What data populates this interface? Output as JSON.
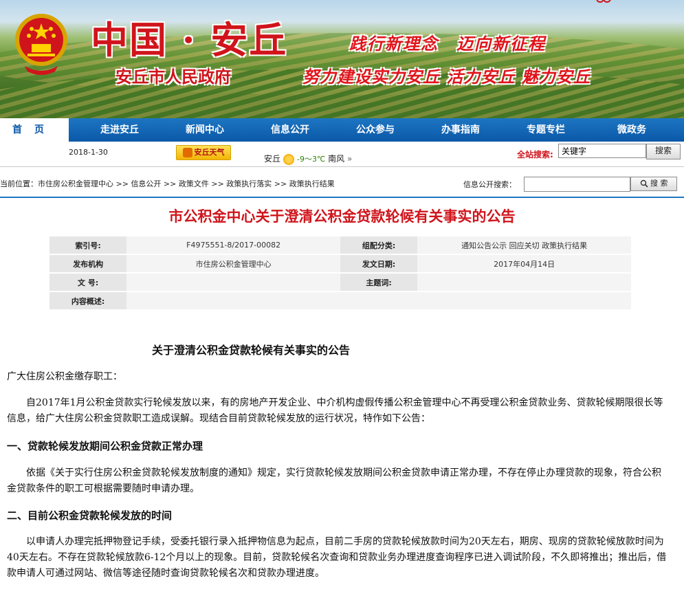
{
  "banner": {
    "title": "中国 · 安丘",
    "subtitle": "安丘市人民政府",
    "slogan1": "践行新理念　迈向新征程",
    "slogan2": "努力建设实力安丘 活力安丘 魅力安丘"
  },
  "nav": {
    "items": [
      "首页",
      "走进安丘",
      "新闻中心",
      "信息公开",
      "公众参与",
      "办事指南",
      "专题专栏",
      "微政务"
    ]
  },
  "infobar": {
    "date": "2018-1-30",
    "weather_button": "安丘天气",
    "city": "安丘",
    "temp": "-9～3℃",
    "wind": "南风",
    "more": "»",
    "search_label": "全站搜索:",
    "search_value": "关键字",
    "search_button": "搜索"
  },
  "breadcrumb": {
    "prefix": "当前位置：",
    "items": [
      "市住房公积金管理中心",
      "信息公开",
      "政策文件",
      "政策执行落实",
      "政策执行结果"
    ],
    "separator": " >> ",
    "gov_search_label": "信息公开搜索：",
    "gov_search_button": "搜 索"
  },
  "headline": "市公积金中心关于澄清公积金贷款轮候有关事实的公告",
  "meta": {
    "index_label": "索引号:",
    "index_value": "F4975551-8/2017-00082",
    "category_label": "组配分类:",
    "category_value": "通知公告公示 回应关切 政策执行结果",
    "publisher_label": "发布机构",
    "publisher_value": "市住房公积金管理中心",
    "date_label": "发文日期:",
    "date_value": "2017年04月14日",
    "docno_label": "文 号:",
    "docno_value": "",
    "subject_label": "主题词:",
    "subject_value": "",
    "summary_label": "内容概述:",
    "summary_value": ""
  },
  "article": {
    "title": "关于澄清公积金贷款轮候有关事实的公告",
    "salutation": "广大住房公积金缴存职工：",
    "p1": "自2017年1月公积金贷款实行轮候发放以来，有的房地产开发企业、中介机构虚假传播公积金管理中心不再受理公积金贷款业务、贷款轮候期限很长等信息，给广大住房公积金贷款职工造成误解。现结合目前贷款轮候发放的运行状况，特作如下公告：",
    "h1": "一、贷款轮候发放期间公积金贷款正常办理",
    "p2": "依据《关于实行住房公积金贷款轮候发放制度的通知》规定，实行贷款轮候发放期间公积金贷款申请正常办理，不存在停止办理贷款的现象，符合公积金贷款条件的职工可根据需要随时申请办理。",
    "h2": "二、目前公积金贷款轮候发放的时间",
    "p3": "以申请人办理完抵押物登记手续，受委托银行录入抵押物信息为起点，目前二手房的贷款轮候放款时间为20天左右，期房、现房的贷款轮候放款时间为40天左右。不存在贷款轮候放款6-12个月以上的现象。目前，贷款轮候名次查询和贷款业务办理进度查询程序已进入调试阶段，不久即将推出；推出后，借款申请人可通过网站、微信等途径随时查询贷款轮候名次和贷款办理进度。"
  }
}
